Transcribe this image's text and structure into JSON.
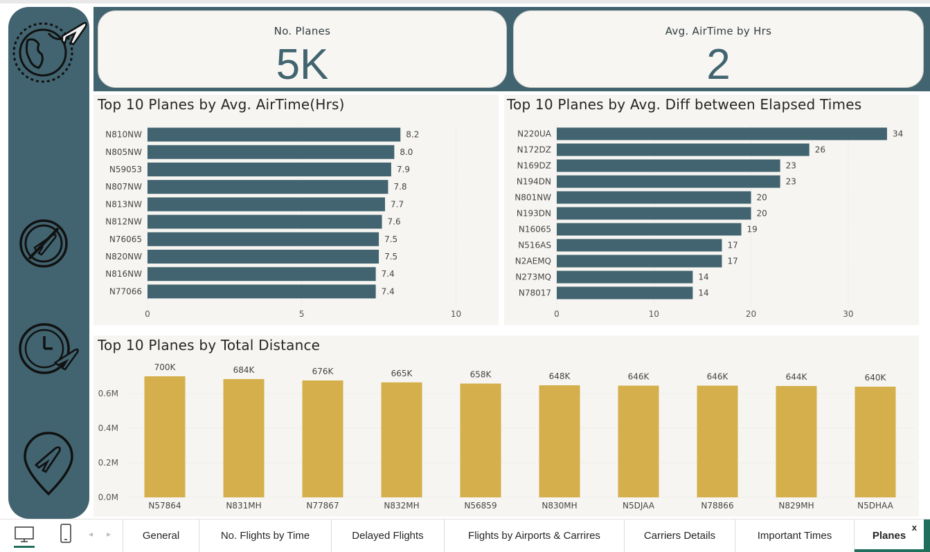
{
  "colors": {
    "teal": "#416470",
    "gold": "#d4af4b",
    "card_bg": "#f7f6f2",
    "accent_green": "#1f6f5c"
  },
  "sidebar": {
    "icons": [
      "globe-plane-icon",
      "no-flights-icon",
      "clock-plane-icon",
      "location-plane-icon"
    ]
  },
  "kpis": [
    {
      "title": "No. Planes",
      "value": "5K"
    },
    {
      "title": "Avg. AirTime by Hrs",
      "value": "2"
    }
  ],
  "chart_data": [
    {
      "type": "bar",
      "orientation": "horizontal",
      "title": "Top 10 Planes by Avg. AirTime(Hrs)",
      "categories": [
        "N810NW",
        "N805NW",
        "N59053",
        "N807NW",
        "N813NW",
        "N812NW",
        "N76065",
        "N820NW",
        "N816NW",
        "N77066"
      ],
      "values": [
        8.2,
        8.0,
        7.9,
        7.8,
        7.7,
        7.6,
        7.5,
        7.5,
        7.4,
        7.4
      ],
      "data_labels": [
        "8.2",
        "8.0",
        "7.9",
        "7.8",
        "7.7",
        "7.6",
        "7.5",
        "7.5",
        "7.4",
        "7.4"
      ],
      "xlim": [
        0,
        11
      ],
      "xticks": [
        0,
        5,
        10
      ],
      "grid": true,
      "color": "#416470"
    },
    {
      "type": "bar",
      "orientation": "horizontal",
      "title": "Top 10 Planes by Avg. Diff between Elapsed Times",
      "categories": [
        "N220UA",
        "N172DZ",
        "N169DZ",
        "N194DN",
        "N801NW",
        "N193DN",
        "N16065",
        "N516AS",
        "N2AEMQ",
        "N273MQ",
        "N78017"
      ],
      "values": [
        34,
        26,
        23,
        23,
        20,
        20,
        19,
        17,
        17,
        14,
        14
      ],
      "xlim": [
        0,
        36
      ],
      "xticks": [
        0,
        10,
        20,
        30
      ],
      "grid": true,
      "color": "#416470"
    },
    {
      "type": "bar",
      "orientation": "vertical",
      "title": "Top 10 Planes by Total Distance",
      "categories": [
        "N57864",
        "N831MH",
        "N77867",
        "N832MH",
        "N56859",
        "N830MH",
        "N5DJAA",
        "N78866",
        "N829MH",
        "N5DHAA"
      ],
      "values": [
        700000,
        684000,
        676000,
        665000,
        658000,
        648000,
        646000,
        646000,
        644000,
        640000
      ],
      "data_labels": [
        "700K",
        "684K",
        "676K",
        "665K",
        "658K",
        "648K",
        "646K",
        "646K",
        "644K",
        "640K"
      ],
      "ylim": [
        0,
        800000
      ],
      "yticks": [
        0,
        200000,
        400000,
        600000
      ],
      "ytick_labels": [
        "0.0M",
        "0.2M",
        "0.4M",
        "0.6M"
      ],
      "grid": true,
      "color": "#d4af4b"
    }
  ],
  "tabs": [
    {
      "label": "General",
      "active": false
    },
    {
      "label": "No. Flights by Time",
      "active": false
    },
    {
      "label": "Delayed Flights",
      "active": false
    },
    {
      "label": "Flights by Airports & Carrires",
      "active": false
    },
    {
      "label": "Carriers Details",
      "active": false
    },
    {
      "label": "Important Times",
      "active": false
    },
    {
      "label": "Planes",
      "active": true
    }
  ],
  "tab_close": "x"
}
